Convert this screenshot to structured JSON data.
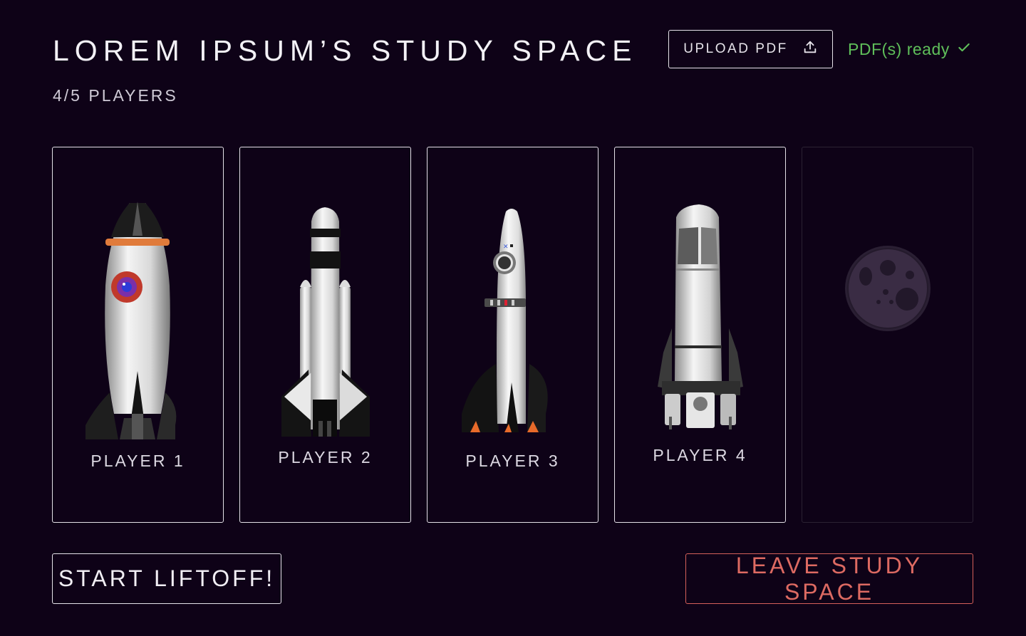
{
  "header": {
    "title": "LOREM IPSUM’S STUDY SPACE",
    "players_count": "4/5 PLAYERS",
    "upload_label": "UPLOAD PDF",
    "pdf_status": "PDF(s) ready"
  },
  "slots": [
    {
      "label": "PLAYER 1",
      "rocket": "rocket-classic-icon"
    },
    {
      "label": "PLAYER 2",
      "rocket": "rocket-shuttle-icon"
    },
    {
      "label": "PLAYER 3",
      "rocket": "rocket-slim-icon"
    },
    {
      "label": "PLAYER 4",
      "rocket": "rocket-heavy-icon"
    },
    {
      "label": "",
      "rocket": "moon-icon"
    }
  ],
  "actions": {
    "start_label": "START LIFTOFF!",
    "leave_label": "LEAVE STUDY SPACE"
  },
  "colors": {
    "background": "#0e0217",
    "ready": "#5fbf5a",
    "leave": "#dd6a62"
  }
}
